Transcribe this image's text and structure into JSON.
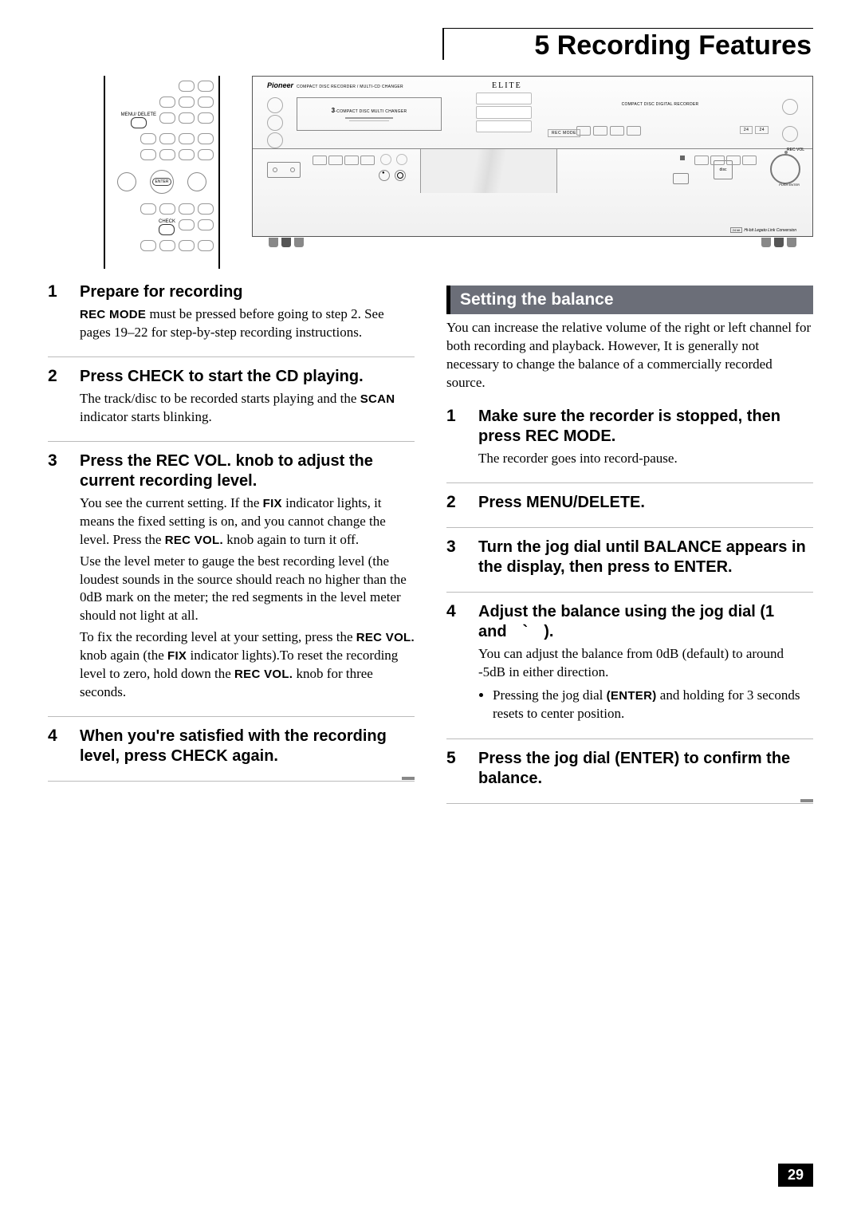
{
  "chapter": {
    "number": "5",
    "title": "5 Recording Features"
  },
  "figures": {
    "remote": {
      "menu_delete": "MENU/\nDELETE",
      "enter": "ENTER",
      "check": "CHECK"
    },
    "unit": {
      "brand": "Pioneer",
      "subtitle": "COMPACT DISC RECORDER / MULTI-CD CHANGER",
      "elite": "ELITE",
      "tray_num": "3",
      "tray_label": "-COMPACT DISC MULTI CHANGER",
      "rec_mode": "REC MODE",
      "right_label": "COMPACT DISC DIGITAL RECORDER",
      "rec_vol": "REC VOL",
      "push_enter": "PUSH ENTER",
      "cd_logo": "disc",
      "hibit_box": "24 bit",
      "hibit": "Hi-bit Legato Link Conversion",
      "btn_24_1": "24",
      "btn_24_2": "24"
    }
  },
  "left_steps": [
    {
      "num": "1",
      "title": "Prepare for recording",
      "paras": [
        "<span class='sc'>REC MODE</span> must be pressed before going to step 2. See pages 19–22 for step-by-step recording instructions."
      ]
    },
    {
      "num": "2",
      "title": "Press CHECK to start the CD playing.",
      "paras": [
        "The track/disc to be recorded starts playing and the <span class='sc'>SCAN</span> indicator starts blinking."
      ]
    },
    {
      "num": "3",
      "title": "Press the REC VOL. knob to adjust the current recording level.",
      "paras": [
        "You see the current setting. If the <span class='sc'>FIX</span> indicator lights, it means the fixed setting is on, and you cannot change the level. Press the <span class='sc'>REC VOL.</span> knob again to turn it off.",
        "Use the level meter to gauge the best recording level (the loudest sounds in the source should reach no higher than the 0dB mark on the meter; the red segments in the level meter should not light at all.",
        "To fix the recording level at your setting, press the <span class='sc'>REC VOL.</span> knob again (the <span class='sc'>FIX</span> indicator lights).To reset the recording level to zero, hold down the <span class='sc'>REC VOL.</span> knob for three seconds."
      ]
    },
    {
      "num": "4",
      "title": "When you're satisfied with the recording level, press CHECK again.",
      "paras": []
    }
  ],
  "right_section": {
    "heading": "Setting the balance",
    "intro": "You can increase the relative volume of the right or left channel for both recording and playback. However, It is generally not necessary to change the balance of a commercially recorded source.",
    "steps": [
      {
        "num": "1",
        "title": "Make sure the recorder is stopped, then press REC MODE.",
        "paras": [
          "The recorder goes into record-pause."
        ]
      },
      {
        "num": "2",
        "title": "Press MENU/DELETE.",
        "paras": []
      },
      {
        "num": "3",
        "title": "Turn the jog dial until BALANCE appears in the display, then press to ENTER.",
        "paras": []
      },
      {
        "num": "4",
        "title": "Adjust the balance using the jog dial (1 and ` ).",
        "paras": [
          "You can adjust the balance from 0dB (default) to around -5dB in either direction."
        ],
        "bullets": [
          "Pressing the jog dial <span class='sc'>(ENTER)</span> and holding for 3 seconds resets to center position."
        ]
      },
      {
        "num": "5",
        "title": "Press the jog dial (ENTER) to confirm the balance.",
        "paras": []
      }
    ]
  },
  "page_number": "29"
}
